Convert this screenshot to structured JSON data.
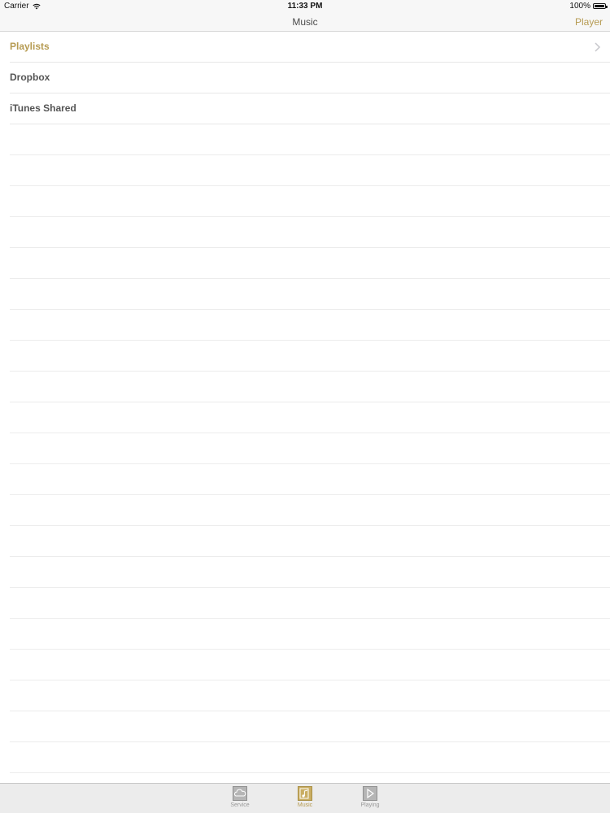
{
  "status_bar": {
    "carrier": "Carrier",
    "time": "11:33 PM",
    "battery": "100%",
    "battery_level": 1.0
  },
  "nav": {
    "title": "Music",
    "right_button": "Player"
  },
  "list": {
    "items": [
      {
        "label": "Playlists",
        "active": true,
        "chevron": true
      },
      {
        "label": "Dropbox",
        "active": false,
        "chevron": false
      },
      {
        "label": "iTunes Shared",
        "active": false,
        "chevron": false
      }
    ]
  },
  "tabs": [
    {
      "label": "Service",
      "icon": "cloud-icon",
      "active": false
    },
    {
      "label": "Music",
      "icon": "music-file-icon",
      "active": true
    },
    {
      "label": "Playing",
      "icon": "play-icon",
      "active": false
    }
  ],
  "colors": {
    "accent": "#b69b52",
    "inactive": "#9a9a9a",
    "text": "#555555"
  }
}
